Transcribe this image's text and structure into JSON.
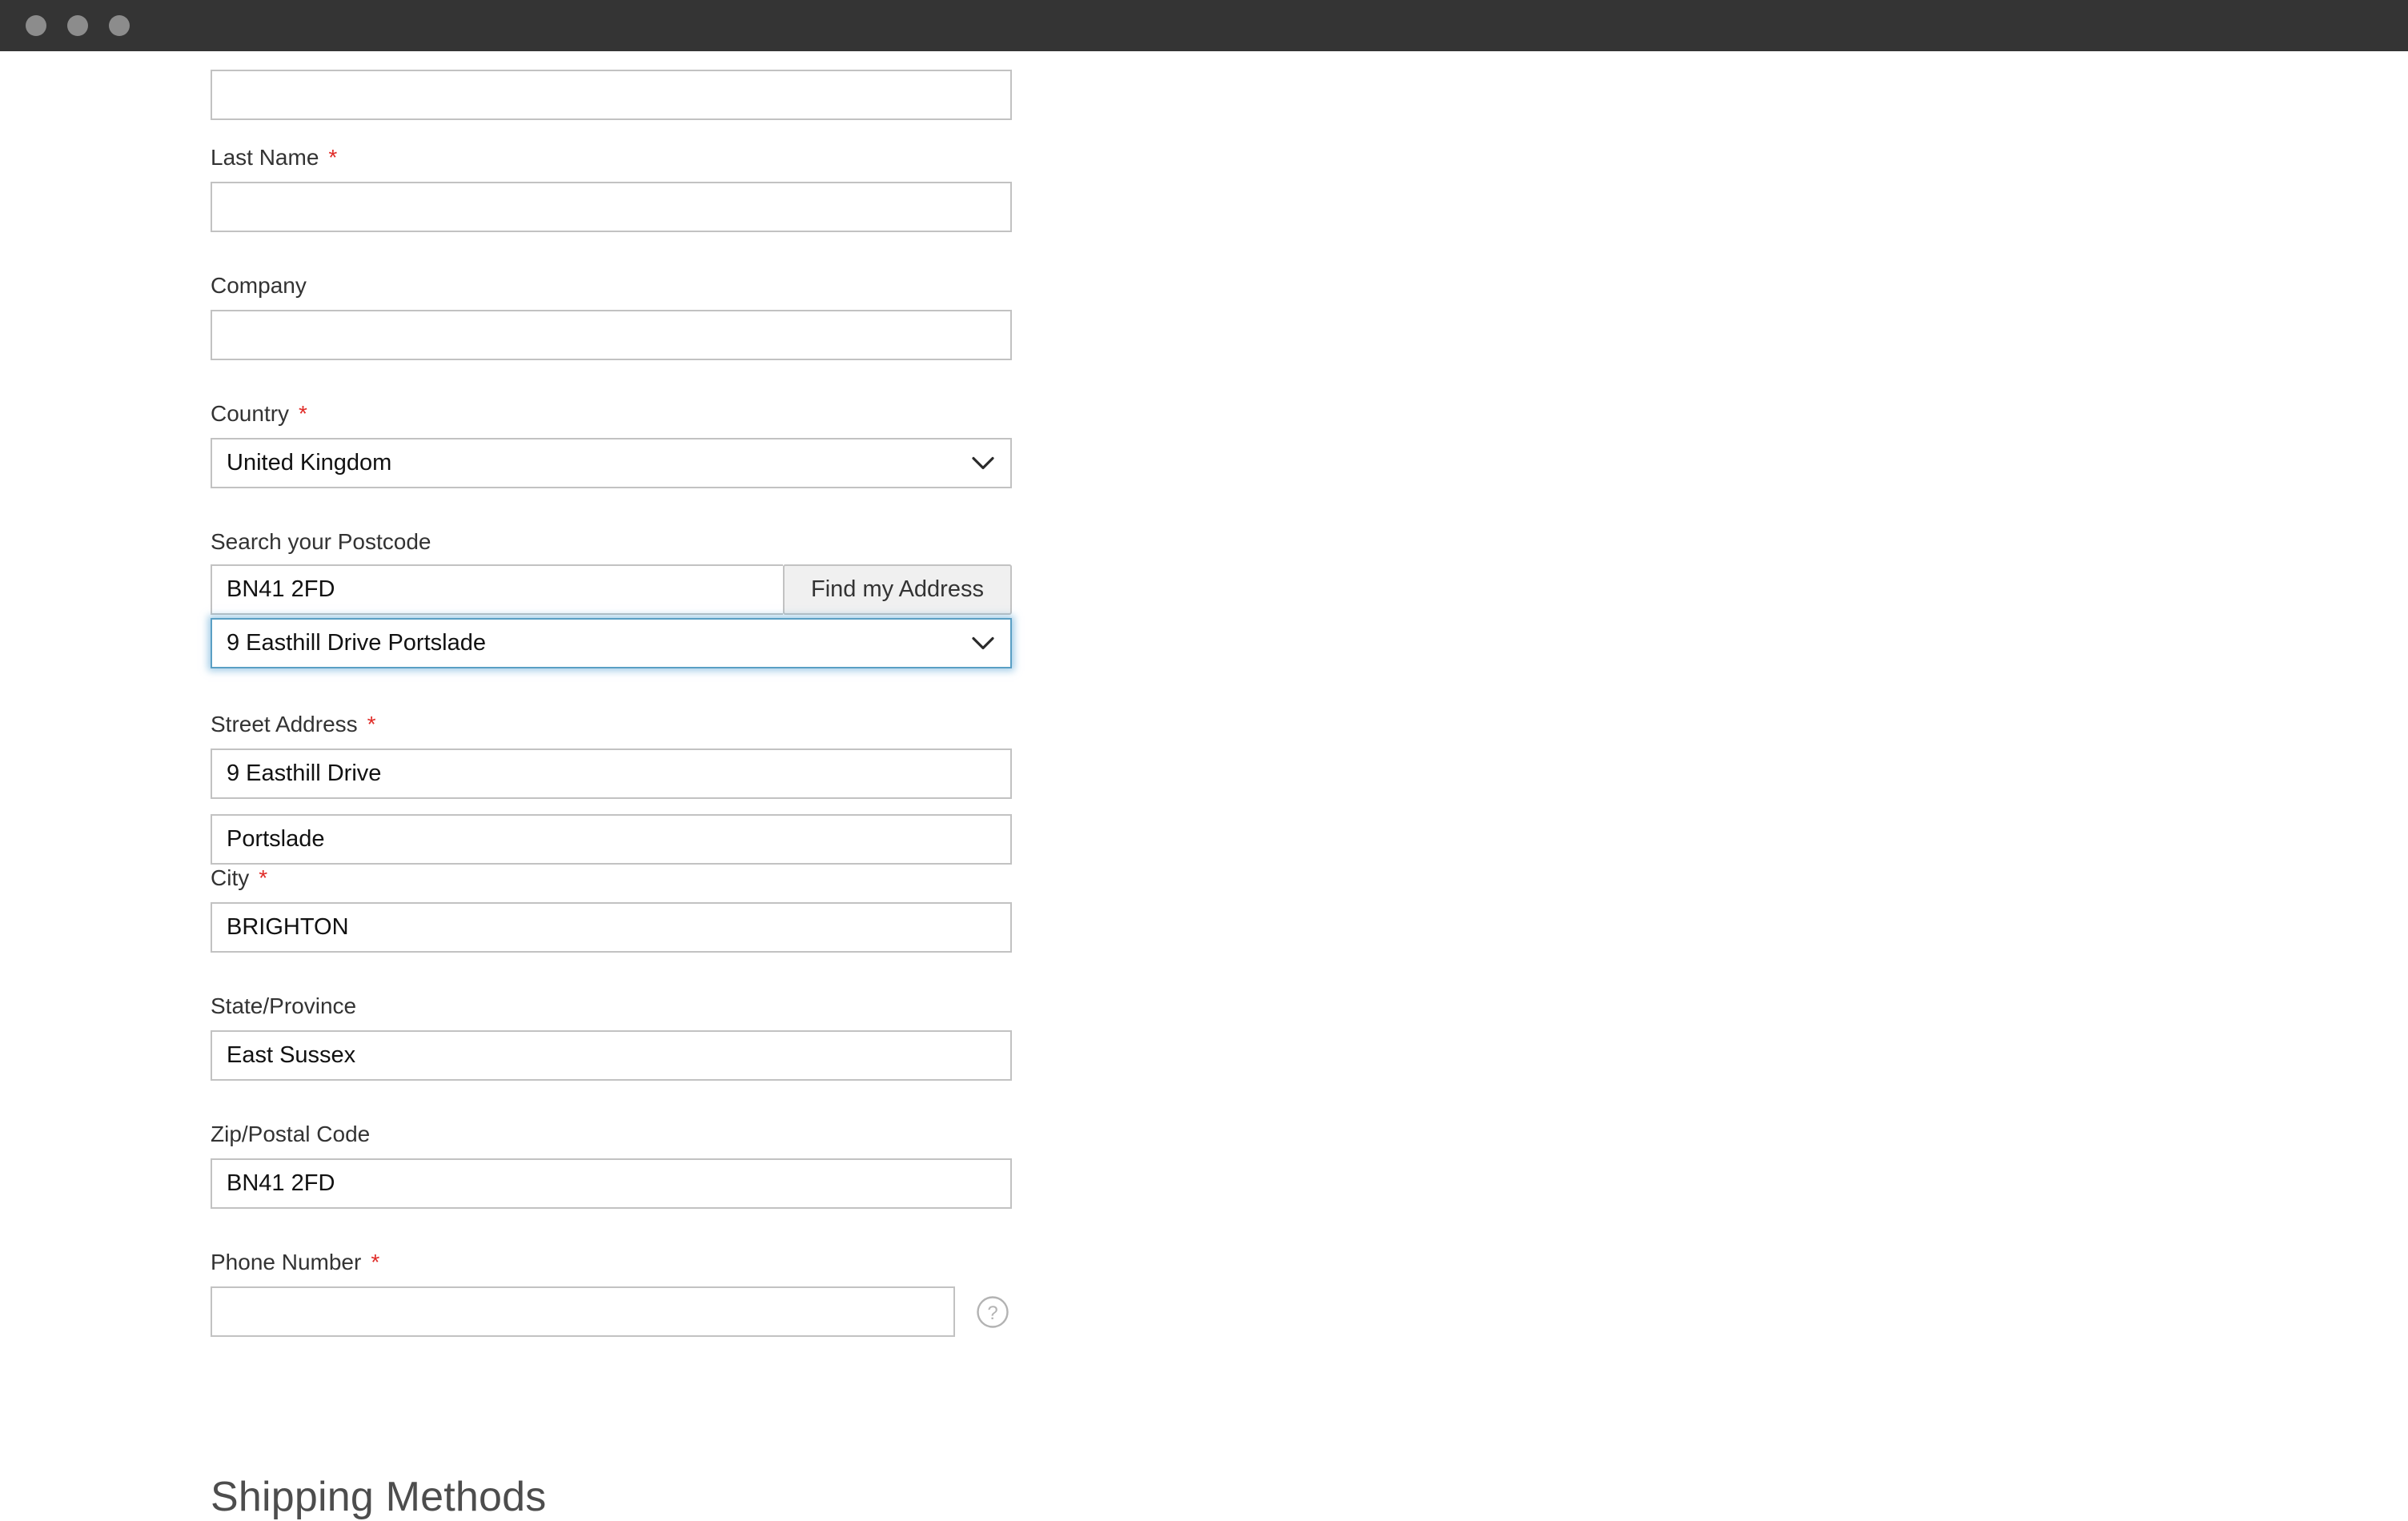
{
  "window": {
    "traffic_lights": [
      "close-dot",
      "minimize-dot",
      "maximize-dot"
    ]
  },
  "form": {
    "heading_shipping_methods": "Shipping Methods",
    "required_marker": "*",
    "fields": [
      {
        "name": "first-name",
        "label": "",
        "required": true,
        "value": "",
        "placeholder": "",
        "type": "text"
      },
      {
        "name": "last-name",
        "label": "Last Name",
        "required": true,
        "value": "",
        "placeholder": "",
        "type": "text"
      },
      {
        "name": "company",
        "label": "Company",
        "required": false,
        "value": "",
        "placeholder": "",
        "type": "text"
      },
      {
        "name": "country",
        "label": "Country",
        "required": true,
        "value": "United Kingdom",
        "placeholder": "",
        "type": "select"
      },
      {
        "name": "postcode-search",
        "label": "Search your Postcode",
        "required": false,
        "value": "BN41 2FD",
        "placeholder": "",
        "type": "text-with-button",
        "button_label": "Find my Address"
      },
      {
        "name": "address-result",
        "label": "",
        "required": false,
        "value": "9 Easthill Drive Portslade",
        "placeholder": "",
        "type": "select",
        "focused": true
      },
      {
        "name": "street-address-line1",
        "label": "Street Address",
        "required": true,
        "value": "9 Easthill Drive",
        "placeholder": "",
        "type": "text"
      },
      {
        "name": "street-address-line2",
        "label": "",
        "required": false,
        "value": "Portslade",
        "placeholder": "",
        "type": "text"
      },
      {
        "name": "city",
        "label": "City",
        "required": true,
        "value": "BRIGHTON",
        "placeholder": "",
        "type": "text"
      },
      {
        "name": "state-province",
        "label": "State/Province",
        "required": false,
        "value": "East Sussex",
        "placeholder": "",
        "type": "text"
      },
      {
        "name": "zip-postal-code",
        "label": "Zip/Postal Code",
        "required": false,
        "value": "BN41 2FD",
        "placeholder": "",
        "type": "text"
      },
      {
        "name": "phone-number",
        "label": "Phone Number",
        "required": true,
        "value": "",
        "placeholder": "",
        "type": "text-with-help",
        "help_icon": "question-mark-circle-icon"
      }
    ]
  },
  "colors": {
    "titlebar": "#343434",
    "traffic_light": "#8c8c8c",
    "label_text": "#333333",
    "input_text": "#111111",
    "input_border": "#c2c2c2",
    "required_red": "#e02b27",
    "focus_blue": "#5a9fc4",
    "button_bg": "#f0f0f0",
    "heading_text": "#4d4d4d"
  }
}
